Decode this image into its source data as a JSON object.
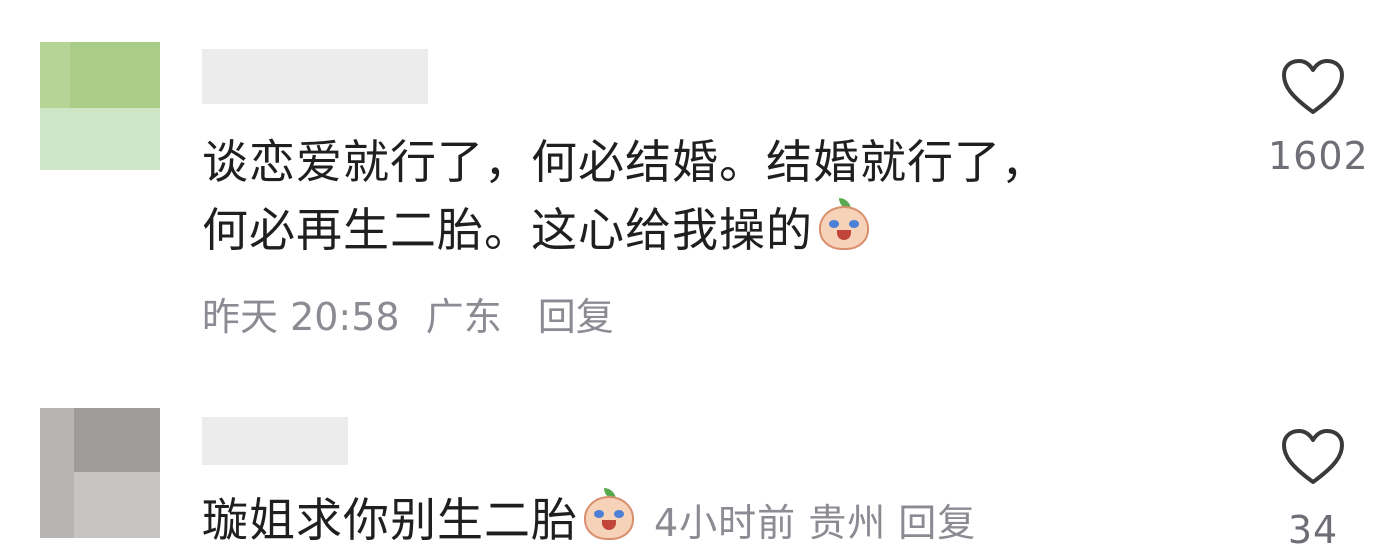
{
  "comments": [
    {
      "text_line1": "谈恋爱就行了，何必结婚。结婚就行了，",
      "text_line2": "何必再生二胎。这心给我操的",
      "emoji": "crying-laughing-peach-emoji",
      "time": "昨天 20:58",
      "location": "广东",
      "reply_label": "回复",
      "likes": "1602"
    },
    {
      "text": "璇姐求你别生二胎",
      "emoji": "crying-peach-emoji",
      "time": "4小时前",
      "location": "贵州",
      "reply_label": "回复",
      "likes": "34"
    }
  ],
  "icons": {
    "like": "heart-outline-icon"
  },
  "colors": {
    "text": "#1f1f1f",
    "meta": "#8b8b93",
    "heart": "#3a3a3a"
  }
}
